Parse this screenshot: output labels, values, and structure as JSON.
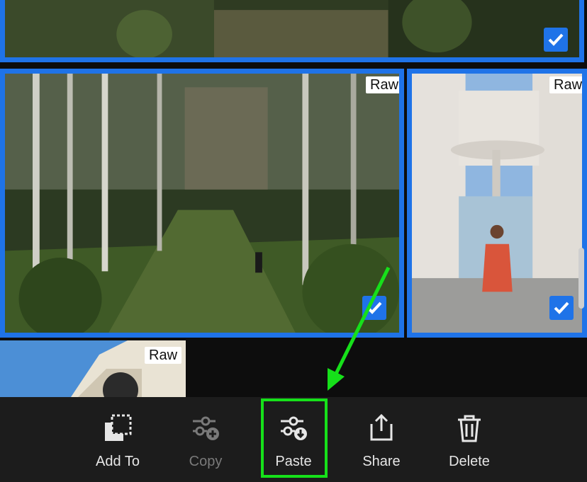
{
  "grid": {
    "tiles": [
      {
        "id": "top-forest",
        "badge": "",
        "checked": true
      },
      {
        "id": "forest-trail",
        "badge": "Raw",
        "checked": true
      },
      {
        "id": "hotel-woman",
        "badge": "Raw",
        "checked": true
      },
      {
        "id": "building-partial",
        "badge": "Raw",
        "checked": false
      }
    ]
  },
  "toolbar": {
    "items": [
      {
        "label": "Add To",
        "icon": "add-to-album-icon",
        "enabled": true
      },
      {
        "label": "Copy",
        "icon": "copy-settings-icon",
        "enabled": false
      },
      {
        "label": "Paste",
        "icon": "paste-settings-icon",
        "enabled": true,
        "highlighted": true
      },
      {
        "label": "Share",
        "icon": "share-icon",
        "enabled": true
      },
      {
        "label": "Delete",
        "icon": "trash-icon",
        "enabled": true
      }
    ]
  },
  "colors": {
    "selection": "#1f73e8",
    "annotation": "#16e01a",
    "toolbar_bg": "#1c1c1c"
  }
}
